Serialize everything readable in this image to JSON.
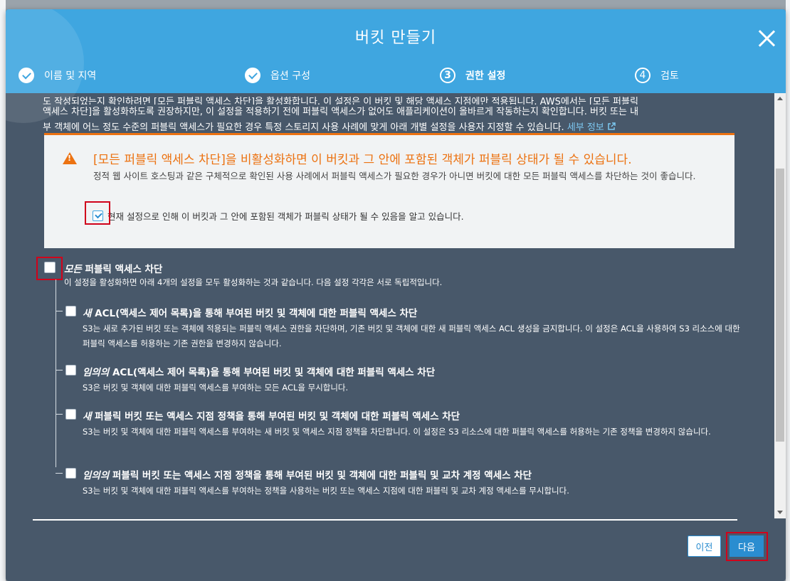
{
  "modal": {
    "title": "버킷 만들기"
  },
  "steps": [
    {
      "num": "",
      "label": "이름 및 지역",
      "state": "done"
    },
    {
      "num": "",
      "label": "옵션 구성",
      "state": "done"
    },
    {
      "num": "3",
      "label": "권한 설정",
      "state": "active"
    },
    {
      "num": "4",
      "label": "검토",
      "state": "pending"
    }
  ],
  "intro": {
    "line1": "도 작성되었는지 확인하려면 [모든 퍼블릭 액세스 차단]을 활성화합니다. 이 설정은 이 버킷 및 해당 액세스 지점에만 적용됩니다. AWS에서는 [모든 퍼블릭",
    "line2": "액세스 차단]을 활성화하도록 권장하지만, 이 설정을 적용하기 전에 퍼블릭 액세스가 없어도 애플리케이션이 올바르게 작동하는지 확인합니다. 버킷 또는 내",
    "line3": "부 객체에 어느 정도 수준의 퍼블릭 액세스가 필요한 경우 특정 스토리지 사용 사례에 맞게 아래 개별 설정을 사용자 지정할 수 있습니다.",
    "link": "세부 정보"
  },
  "warning": {
    "title": "[모든 퍼블릭 액세스 차단]을 비활성화하면 이 버킷과 그 안에 포함된 객체가 퍼블릭 상태가 될 수 있습니다.",
    "body": "정적 웹 사이트 호스팅과 같은 구체적으로 확인된 사용 사례에서 퍼블릭 액세스가 필요한 경우가 아니면 버킷에 대한 모든 퍼블릭 액세스를 차단하는 것이 좋습니다.",
    "ack": "현재 설정으로 인해 이 버킷과 그 안에 포함된 객체가 퍼블릭 상태가 될 수 있음을 알고 있습니다.",
    "ack_checked": true
  },
  "block_all": {
    "em": "모든",
    "label": " 퍼블릭 액세스 차단",
    "desc": "이 설정을 활성화하면 아래 4개의 설정을 모두 활성화하는 것과 같습니다. 다음 설정 각각은 서로 독립적입니다.",
    "checked": false
  },
  "sub_options": [
    {
      "em": "새",
      "label": " ACL(액세스 제어 목록)을 통해 부여된 버킷 및 객체에 대한 퍼블릭 액세스 차단",
      "desc": "S3는 새로 추가된 버킷 또는 객체에 적용되는 퍼블릭 액세스 권한을 차단하며, 기존 버킷 및 객체에 대한 새 퍼블릭 액세스 ACL 생성을 금지합니다. 이 설정은 ACL을 사용하여 S3 리소스에 대한 퍼블릭 액세스를 허용하는 기존 권한을 변경하지 않습니다."
    },
    {
      "em": "임의의",
      "label": " ACL(액세스 제어 목록)을 통해 부여된 버킷 및 객체에 대한 퍼블릭 액세스 차단",
      "desc": "S3은 버킷 및 객체에 대한 퍼블릭 액세스를 부여하는 모든 ACL을 무시합니다."
    },
    {
      "em": "새",
      "label": " 퍼블릭 버킷 또는 액세스 지점 정책을 통해 부여된 버킷 및 객체에 대한 퍼블릭 액세스 차단",
      "desc": "S3는 버킷 및 객체에 대한 퍼블릭 액세스를 부여하는 새 버킷 및 액세스 지점 정책을 차단합니다. 이 설정은 S3 리소스에 대한 퍼블릭 액세스를 허용하는 기존 정책을 변경하지 않습니다."
    },
    {
      "em": "임의의",
      "label": " 퍼블릭 버킷 또는 액세스 지점 정책을 통해 부여된 버킷 및 객체에 대한 퍼블릭 및 교차 계정 액세스 차단",
      "desc": "S3는 버킷 및 객체에 대한 퍼블릭 액세스를 부여하는 정책을 사용하는 버킷 또는 액세스 지점에 대한 퍼블릭 및 교차 계정 액세스를 무시합니다."
    }
  ],
  "footer": {
    "prev_label": "이전",
    "next_label": "다음"
  },
  "colors": {
    "header": "#3fa6e0",
    "body": "#48586a",
    "warning": "#ec7211",
    "highlight": "#d0021b",
    "primary": "#2a8dd0"
  }
}
